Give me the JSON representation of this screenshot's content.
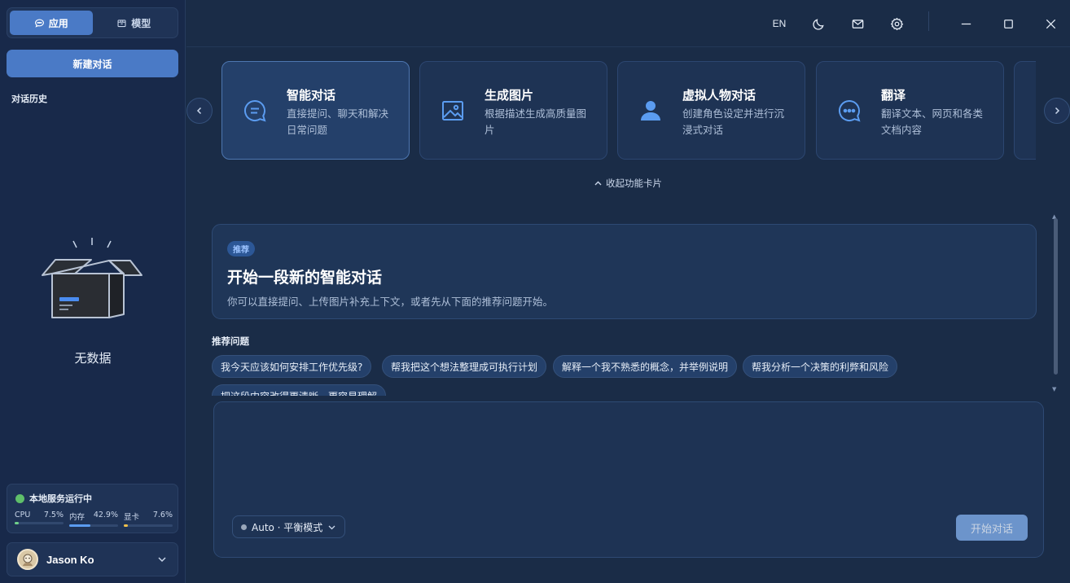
{
  "sidebar": {
    "tabs": [
      {
        "label": "应用",
        "icon": "chat-bubble-icon",
        "active": true
      },
      {
        "label": "模型",
        "icon": "cube-icon",
        "active": false
      }
    ],
    "new_chat_label": "新建对话",
    "history_title": "对话历史",
    "empty_text": "无数据",
    "status": {
      "title": "本地服务运行中",
      "color": "#5fbf6a",
      "metrics": [
        {
          "label": "CPU",
          "value": "7.5%",
          "level": 0.075,
          "color": "#6fd08a"
        },
        {
          "label": "内存",
          "value": "42.9%",
          "level": 0.429,
          "color": "#5b9cf0"
        },
        {
          "label": "显卡",
          "value": "7.6%",
          "level": 0.076,
          "color": "#f0c14b"
        }
      ]
    },
    "user": {
      "name": "Jason Ko"
    }
  },
  "topbar": {
    "lang": "EN",
    "icons": [
      "moon-icon",
      "mail-icon",
      "gear-icon",
      "minimize-icon",
      "maximize-icon",
      "close-icon"
    ]
  },
  "features": [
    {
      "title": "智能对话",
      "desc": "直接提问、聊天和解决日常问题",
      "icon": "chat-icon",
      "active": true
    },
    {
      "title": "生成图片",
      "desc": "根据描述生成高质量图片",
      "icon": "image-icon",
      "active": false
    },
    {
      "title": "虚拟人物对话",
      "desc": "创建角色设定并进行沉浸式对话",
      "icon": "person-icon",
      "active": false
    },
    {
      "title": "翻译",
      "desc": "翻译文本、网页和各类文档内容",
      "icon": "translate-chat-icon",
      "active": false
    }
  ],
  "collapse_label": "收起功能卡片",
  "welcome": {
    "badge": "推荐",
    "title": "开始一段新的智能对话",
    "subtitle": "你可以直接提问、上传图片补充上下文，或者先从下面的推荐问题开始。"
  },
  "suggestions": {
    "title": "推荐问题",
    "items": [
      "我今天应该如何安排工作优先级?",
      "帮我把这个想法整理成可执行计划",
      "解释一个我不熟悉的概念，并举例说明",
      "帮我分析一个决策的利弊和风险",
      "把这段内容改得更清晰、更容易理解"
    ]
  },
  "composer": {
    "model_label": "Auto · 平衡模式",
    "send_label": "开始对话"
  },
  "colors": {
    "accent": "#4a7ac6",
    "background": "#1a2c47",
    "sidebar": "#18294a"
  }
}
